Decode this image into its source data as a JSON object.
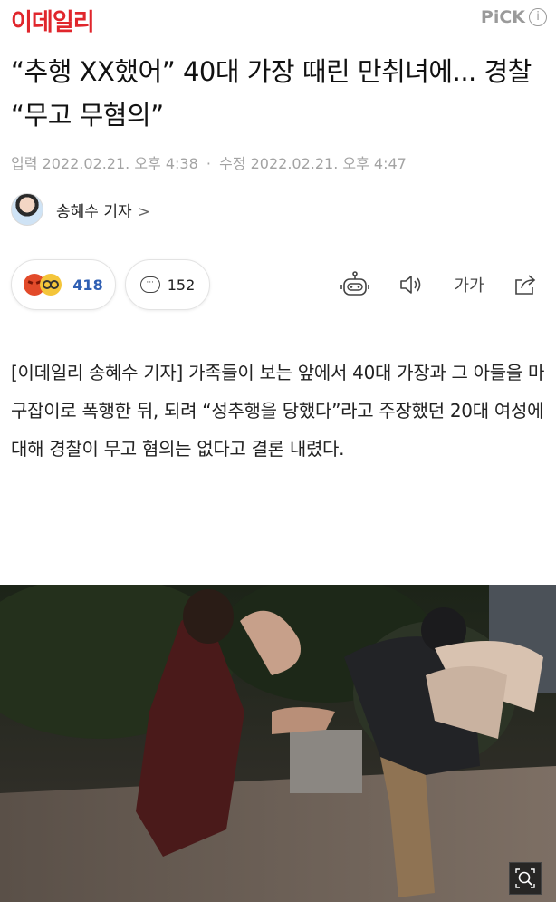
{
  "header": {
    "logo": "이데일리",
    "pick_label": "PiCK",
    "info_icon": "info-icon"
  },
  "article": {
    "headline": "“추행 XX했어” 40대 가장 때린 만취녀에... 경찰 “무고 무혐의”",
    "input_label": "입력",
    "input_date": "2022.02.21. 오후 4:38",
    "separator": "·",
    "modified_label": "수정",
    "modified_date": "2022.02.21. 오후 4:47",
    "author": "송혜수 기자",
    "author_chevron": ">",
    "reaction_count": "418",
    "comment_count": "152",
    "font_tool_label": "가가",
    "body": "[이데일리 송혜수 기자] 가족들이 보는 앞에서 40대 가장과 그 아들을 마구잡이로 폭행한 뒤, 되려 “성추행을 당했다”라고 주장했던 20대 여성에 대해 경찰이 무고 혐의는 없다고 결론 내렸다."
  },
  "colors": {
    "brand": "#e0262c",
    "reaction_count": "#2f5fb3",
    "meta_text": "#a3a3a3"
  },
  "icons": [
    "info-icon",
    "angry-emoji-icon",
    "shocked-emoji-icon",
    "comment-icon",
    "robot-icon",
    "speaker-icon",
    "font-size-icon",
    "share-icon",
    "zoom-icon"
  ]
}
